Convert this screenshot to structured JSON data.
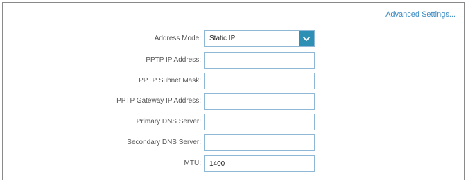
{
  "header": {
    "advanced_settings_link": "Advanced Settings..."
  },
  "form": {
    "address_mode": {
      "label": "Address Mode:",
      "selected": "Static IP"
    },
    "pptp_ip_address": {
      "label": "PPTP IP Address:",
      "value": ""
    },
    "pptp_subnet_mask": {
      "label": "PPTP Subnet Mask:",
      "value": ""
    },
    "pptp_gateway_ip_address": {
      "label": "PPTP Gateway IP Address:",
      "value": ""
    },
    "primary_dns_server": {
      "label": "Primary DNS Server:",
      "value": ""
    },
    "secondary_dns_server": {
      "label": "Secondary DNS Server:",
      "value": ""
    },
    "mtu": {
      "label": "MTU:",
      "value": "1400"
    }
  },
  "icons": {
    "dropdown": "chevron-down-icon"
  },
  "colors": {
    "accent": "#2e8fb4",
    "link": "#3b8bc2",
    "field_border": "#8fb8d6",
    "label_text": "#555555"
  }
}
